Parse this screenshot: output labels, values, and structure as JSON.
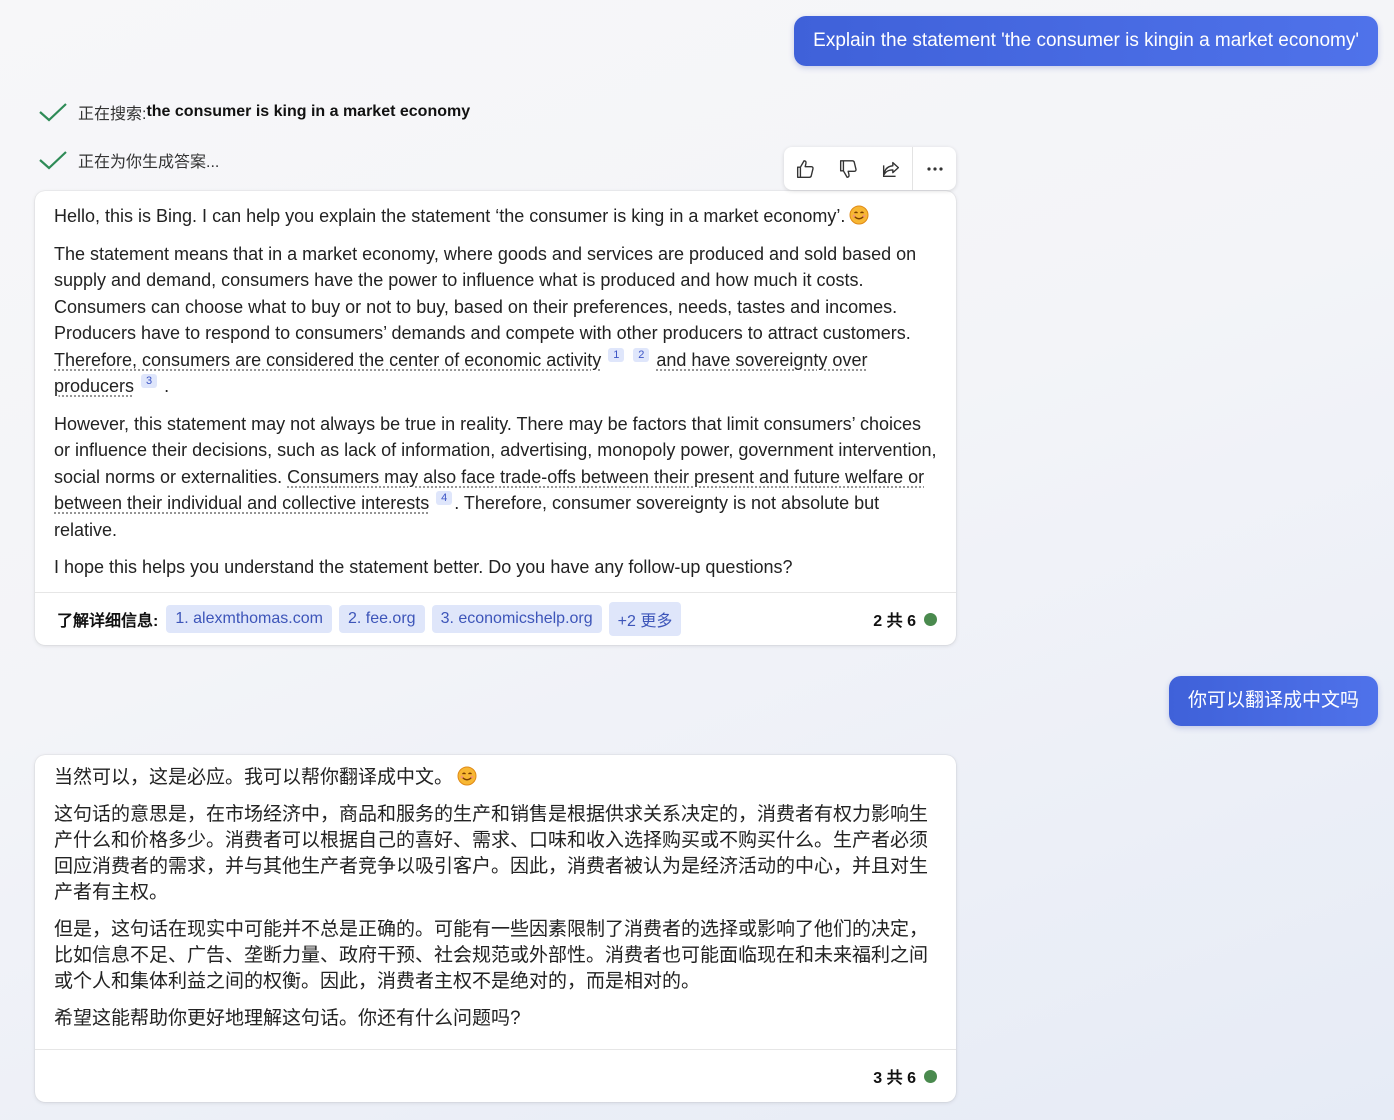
{
  "user_messages": {
    "first": "Explain the statement 'the consumer is kingin a market economy'",
    "second": "你可以翻译成中文吗"
  },
  "status": {
    "searching_prefix": "正在搜索: ",
    "searching_query": "the consumer is king in a market economy",
    "generating": "正在为你生成答案..."
  },
  "response1": {
    "intro": "Hello, this is Bing. I can help you explain the statement ‘the consumer is king in a market economy’.",
    "p1_text": "The statement means that in a market economy, where goods and services are produced and sold based on supply and demand, consumers have the power to influence what is produced and how much it costs. Consumers can choose what to buy or not to buy, based on their preferences, needs, tastes and incomes. Producers have to respond to consumers’ demands and compete with other producers to attract customers. ",
    "p1_cite1": "Therefore, consumers are considered the center of economic activity",
    "p1_cite2": "and have sovereignty over producers",
    "p1_end": ".",
    "p2_text": "However, this statement may not always be true in reality. There may be factors that limit consumers’ choices or influence their decisions, such as lack of information, advertising, monopoly power, government intervention, social norms or externalities. ",
    "p2_cite": "Consumers may also face trade-offs between their present and future welfare or between their individual and collective interests",
    "p2_end": ". Therefore, consumer sovereignty is not absolute but relative.",
    "closing": "I hope this helps you understand the statement better. Do you have any follow-up questions?",
    "refs": [
      "1",
      "2",
      "3",
      "4"
    ],
    "learn_more": "了解详细信息:",
    "sources": [
      "1. alexmthomas.com",
      "2. fee.org",
      "3. economicshelp.org",
      "+2 更多"
    ],
    "count": "2 共 6"
  },
  "response2": {
    "intro": "当然可以，这是必应。我可以帮你翻译成中文。",
    "p1": "这句话的意思是，在市场经济中，商品和服务的生产和销售是根据供求关系决定的，消费者有权力影响生产什么和价格多少。消费者可以根据自己的喜好、需求、口味和收入选择购买或不购买什么。生产者必须回应消费者的需求，并与其他生产者竞争以吸引客户。因此，消费者被认为是经济活动的中心，并且对生产者有主权。",
    "p2": "但是，这句话在现实中可能并不总是正确的。可能有一些因素限制了消费者的选择或影响了他们的决定，比如信息不足、广告、垄断力量、政府干预、社会规范或外部性。消费者也可能面临现在和未来福利之间或个人和集体利益之间的权衡。因此，消费者主权不是绝对的，而是相对的。",
    "closing": "希望这能帮助你更好地理解这句话。你还有什么问题吗?",
    "count": "3 共 6"
  },
  "colors": {
    "accent": "#4565e0",
    "check": "#2e8b57",
    "status_dot": "#4a8a4e",
    "pill_bg": "#dfe6fa"
  },
  "icons": [
    "check-icon",
    "thumbs-up-icon",
    "thumbs-down-icon",
    "share-icon",
    "more-icon",
    "smiling-emoji-icon"
  ]
}
